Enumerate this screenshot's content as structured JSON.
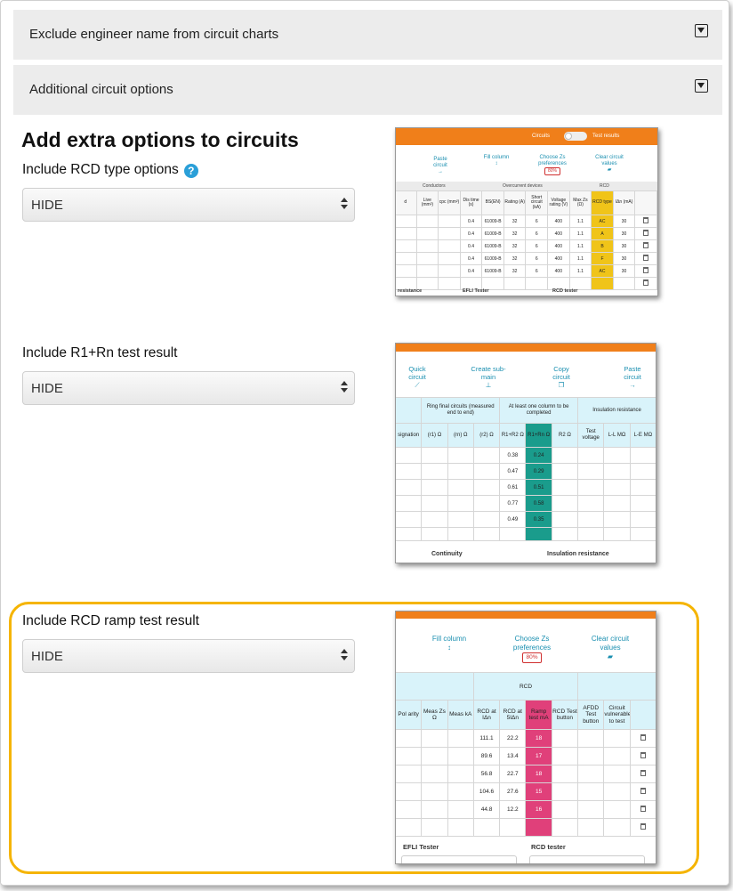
{
  "accordions": [
    {
      "label": "Exclude engineer name from circuit charts"
    },
    {
      "label": "Additional circuit options"
    }
  ],
  "heading": "Add extra options to circuits",
  "help_glyph": "?",
  "options": [
    {
      "label": "Include RCD type options",
      "value": "HIDE"
    },
    {
      "label": "Include R1+Rn test result",
      "value": "HIDE"
    },
    {
      "label": "Include RCD ramp test result",
      "value": "HIDE"
    }
  ],
  "preview1": {
    "toggle": {
      "left": "Circuits",
      "right": "Test results"
    },
    "toolbar": [
      {
        "label": "Paste circuit",
        "icon": "arrow-right-icon"
      },
      {
        "label": "Fill column",
        "icon": "updown-arrow-icon"
      },
      {
        "label": "Choose Zs preferences",
        "badge": "80%"
      },
      {
        "label": "Clear circuit values",
        "icon": "eraser-icon"
      }
    ],
    "group_headers": [
      "Conductors",
      "Overcurrent devices",
      "RCD"
    ],
    "columns": [
      "d",
      "Live (mm²)",
      "cpc (mm²)",
      "Dis time (s)",
      "BS(EN)",
      "Rating (A)",
      "Short circuit (kA)",
      "Voltage rating (V)",
      "Max Zs (Ω)",
      "RCD type",
      "IΔn (mA)",
      ""
    ],
    "rows": [
      [
        "",
        "",
        "",
        "0.4",
        "61009-B",
        "32",
        "6",
        "400",
        "1.1",
        "AC",
        "30"
      ],
      [
        "",
        "",
        "",
        "0.4",
        "61009-B",
        "32",
        "6",
        "400",
        "1.1",
        "A",
        "30"
      ],
      [
        "",
        "",
        "",
        "0.4",
        "61009-B",
        "32",
        "6",
        "400",
        "1.1",
        "B",
        "30"
      ],
      [
        "",
        "",
        "",
        "0.4",
        "61009-B",
        "32",
        "6",
        "400",
        "1.1",
        "F",
        "30"
      ],
      [
        "",
        "",
        "",
        "0.4",
        "61009-B",
        "32",
        "6",
        "400",
        "1.1",
        "AC",
        "30"
      ]
    ],
    "footer": [
      "resistance",
      "EFLI Tester",
      "RCD tester"
    ]
  },
  "preview2": {
    "toolbar": [
      {
        "label": "Quick circuit",
        "icon": "wand-icon"
      },
      {
        "label": "Create sub-main",
        "icon": "hierarchy-icon"
      },
      {
        "label": "Copy circuit",
        "icon": "copy-icon"
      },
      {
        "label": "Paste circuit",
        "icon": "arrow-right-icon"
      }
    ],
    "group_headers": [
      "Ring final circuits (measured end to end)",
      "At least one column to be completed",
      "Insulation resistance"
    ],
    "columns": [
      "signation",
      "(r1) Ω",
      "(rn) Ω",
      "(r2) Ω",
      "R1+R2 Ω",
      "R1+Rn Ω",
      "R2 Ω",
      "Test voltage",
      "L-L MΩ",
      "L-E MΩ"
    ],
    "r1r2": [
      "0.38",
      "0.47",
      "0.61",
      "0.77",
      "0.49"
    ],
    "r1rn": [
      "0.24",
      "0.29",
      "0.51",
      "0.58",
      "0.35"
    ],
    "footer": [
      "Continuity",
      "Insulation resistance"
    ]
  },
  "preview3": {
    "toolbar": [
      {
        "label": "Fill column",
        "icon": "updown-arrow-icon"
      },
      {
        "label": "Choose Zs preferences",
        "badge": "80%"
      },
      {
        "label": "Clear circuit values",
        "icon": "eraser-icon"
      }
    ],
    "group_header": "RCD",
    "columns": [
      "Pol arity",
      "Meas Zs Ω",
      "Meas kA",
      "RCD at IΔn",
      "RCD at 5IΔn",
      "Ramp test mA",
      "RCD Test button",
      "AFDD Test button",
      "Circuit vulnerable to test",
      ""
    ],
    "rows": [
      [
        "111.1",
        "22.2",
        "18"
      ],
      [
        "89.6",
        "13.4",
        "17"
      ],
      [
        "56.8",
        "22.7",
        "18"
      ],
      [
        "104.6",
        "27.6",
        "15"
      ],
      [
        "44.8",
        "12.2",
        "16"
      ]
    ],
    "footer": [
      "EFLI Tester",
      "RCD tester"
    ]
  },
  "colors": {
    "orange": "#f07f1a",
    "teal": "#1a9c8c",
    "pink": "#e0407a",
    "yellow": "#f0c419",
    "highlight": "#f5b400",
    "accent_blue": "#2a9fd8"
  }
}
